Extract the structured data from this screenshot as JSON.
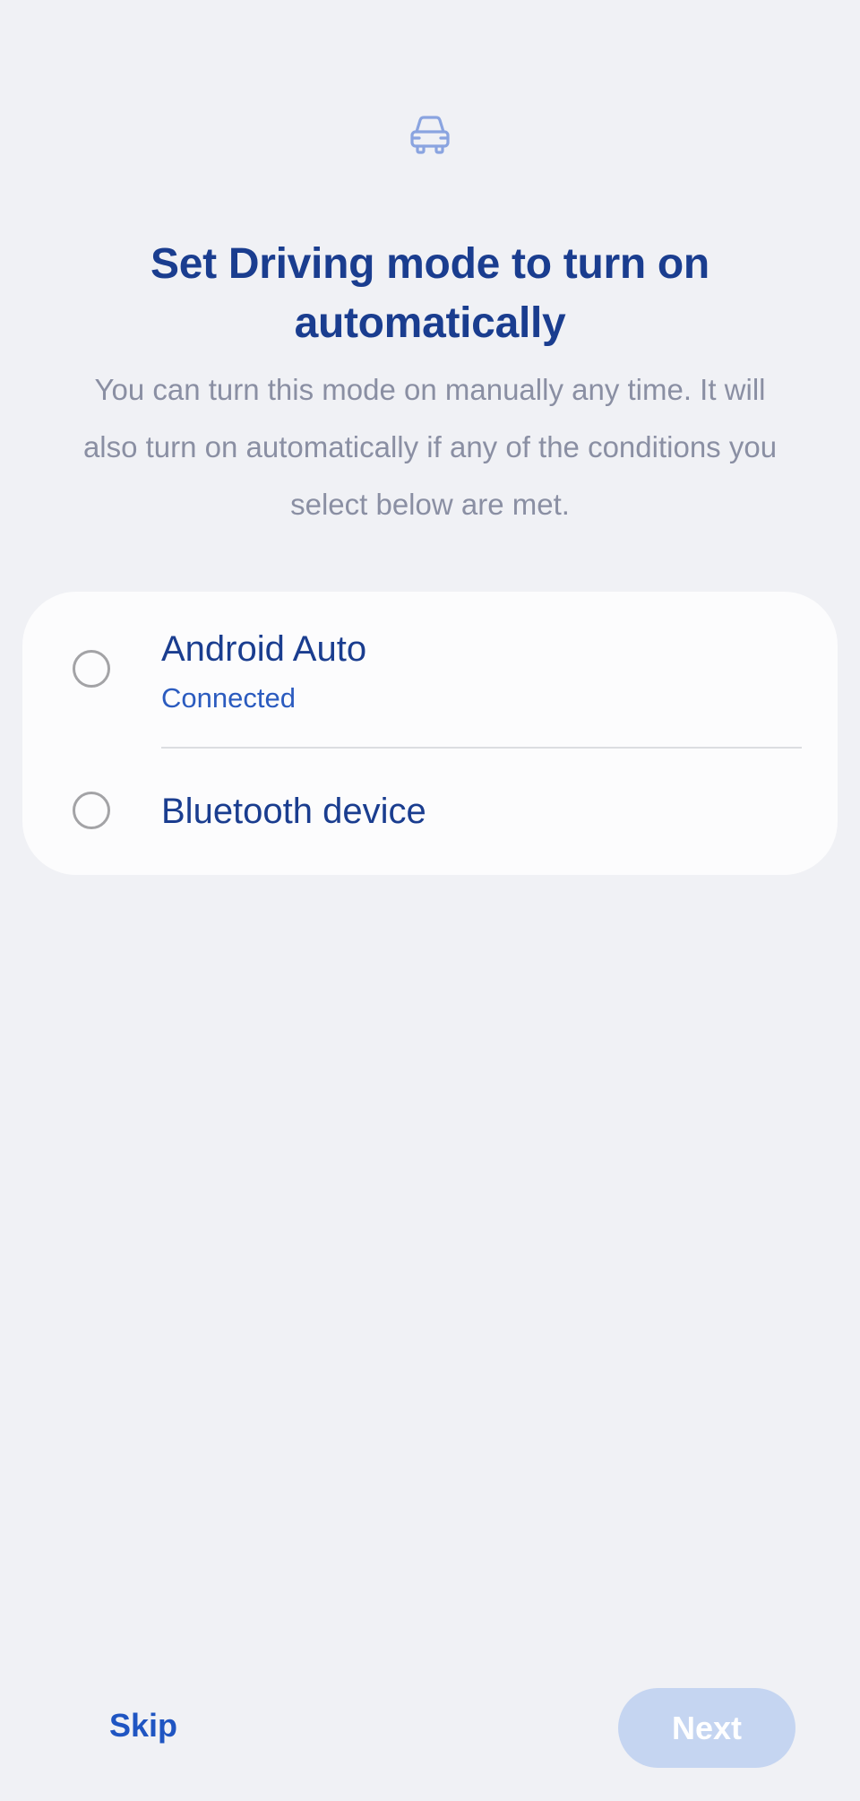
{
  "header": {
    "icon": "car-icon",
    "title": "Set Driving mode to turn on automatically",
    "subtitle": "You can turn this mode on manually any time. It will also turn on automatically if any of the conditions you select below are met."
  },
  "options": [
    {
      "label": "Android Auto",
      "sublabel": "Connected",
      "selected": false
    },
    {
      "label": "Bluetooth device",
      "selected": false
    }
  ],
  "footer": {
    "skip_label": "Skip",
    "next_label": "Next"
  },
  "colors": {
    "background": "#f0f1f5",
    "primary": "#1a3d8f",
    "accent": "#1f55c2",
    "next_disabled": "#c5d5f1",
    "icon": "#8aa4e0"
  }
}
